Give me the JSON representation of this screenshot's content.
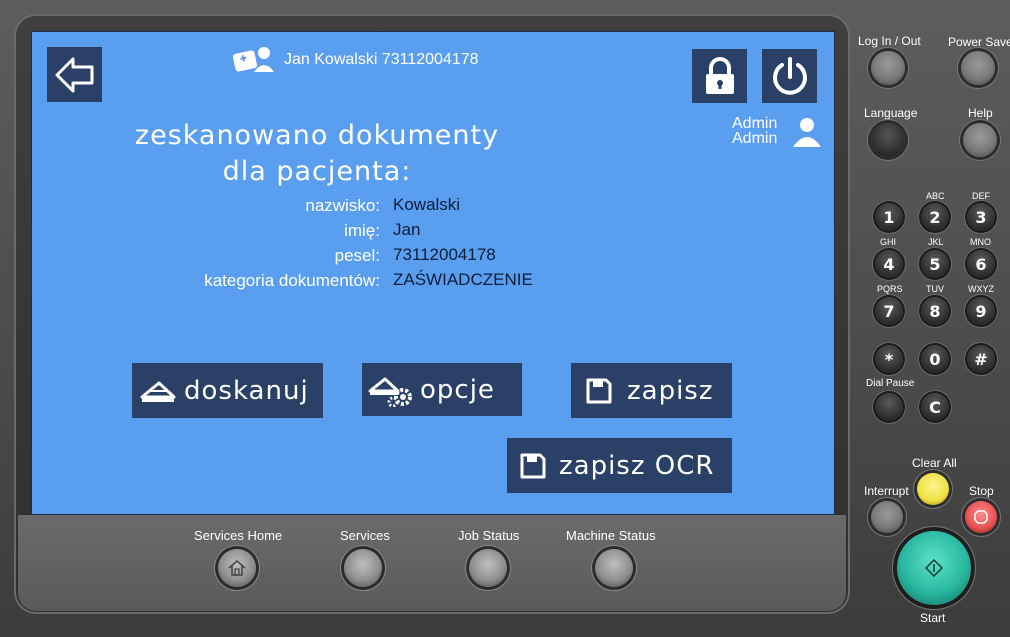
{
  "header": {
    "user_label": "Jan Kowalski 73112004178",
    "admin_line1": "Admin",
    "admin_line2": "Admin"
  },
  "main": {
    "title_line1": "zeskanowano dokumenty",
    "title_line2": "dla pacjenta:",
    "fields": [
      {
        "label": "nazwisko:",
        "value": "Kowalski"
      },
      {
        "label": "imię:",
        "value": "Jan"
      },
      {
        "label": "pesel:",
        "value": "73112004178"
      },
      {
        "label": "kategoria dokumentów:",
        "value": "ZAŚWIADCZENIE"
      }
    ]
  },
  "actions": {
    "rescan": "doskanuj",
    "options": "opcje",
    "save": "zapisz",
    "save_ocr": "zapisz OCR"
  },
  "hardkeys": {
    "login": "Log In / Out",
    "power_saver": "Power Saver",
    "language": "Language",
    "help": "Help",
    "dial_pause": "Dial Pause",
    "clear_all": "Clear All",
    "interrupt": "Interrupt",
    "stop": "Stop",
    "start": "Start",
    "services_home": "Services Home",
    "services": "Services",
    "job_status": "Job Status",
    "machine_status": "Machine Status"
  },
  "keypad": [
    {
      "key": "1",
      "sub": ""
    },
    {
      "key": "2",
      "sub": "ABC"
    },
    {
      "key": "3",
      "sub": "DEF"
    },
    {
      "key": "4",
      "sub": "GHI"
    },
    {
      "key": "5",
      "sub": "JKL"
    },
    {
      "key": "6",
      "sub": "MNO"
    },
    {
      "key": "7",
      "sub": "PQRS"
    },
    {
      "key": "8",
      "sub": "TUV"
    },
    {
      "key": "9",
      "sub": "WXYZ"
    },
    {
      "key": "*",
      "sub": ""
    },
    {
      "key": "0",
      "sub": ""
    },
    {
      "key": "#",
      "sub": ""
    },
    {
      "key": "C",
      "sub": ""
    }
  ],
  "icons": {
    "back": "back-arrow-icon",
    "patient": "patient-card-icon",
    "lock": "lock-icon",
    "power": "power-icon",
    "admin": "admin-user-icon",
    "scanner": "scanner-icon",
    "settings": "scanner-gear-icon",
    "save": "floppy-disk-icon",
    "home": "home-icon",
    "start": "start-diamond-icon",
    "stop": "stop-icon"
  },
  "colors": {
    "screen_bg": "#5a9ef0",
    "tile_bg": "#2a4066",
    "clear_all": "#f0e040",
    "stop": "#e85050",
    "start": "#2ab8a0"
  }
}
